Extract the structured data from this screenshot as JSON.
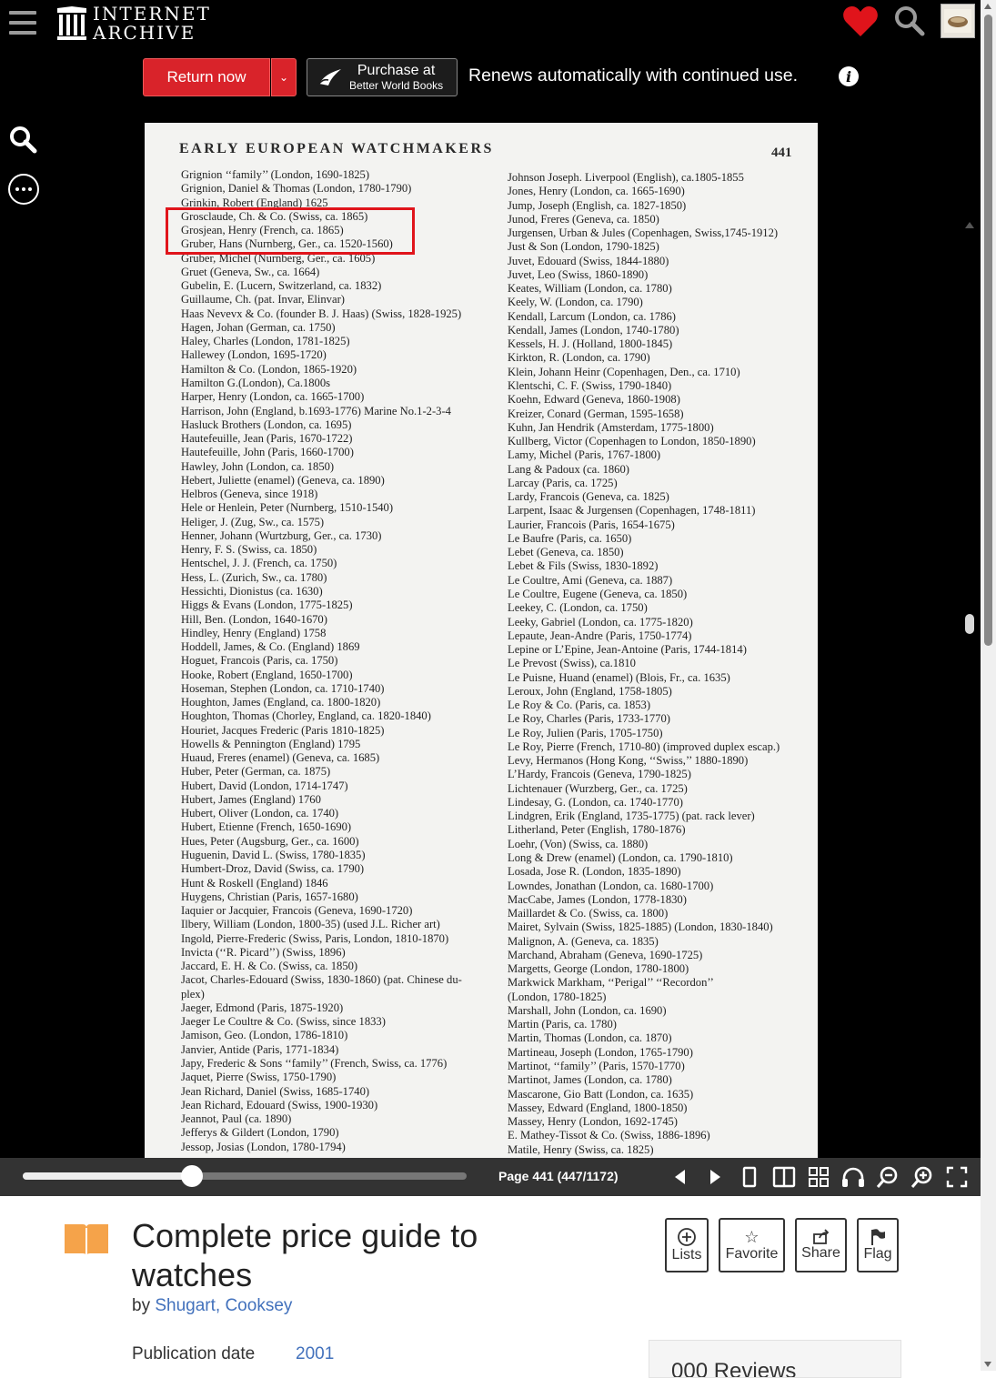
{
  "nav": {
    "logo_line1": "INTERNET",
    "logo_line2": "ARCHIVE",
    "icons": [
      "hamburger-menu-icon",
      "internet-archive-logo-icon",
      "heart-icon",
      "search-icon",
      "user-avatar"
    ],
    "accent_heart": "#e0141b"
  },
  "loan": {
    "return_label": "Return now",
    "purchase_main": "Purchase at",
    "purchase_sub": "Better World Books",
    "renew_text": "Renews automatically with continued use.",
    "info_glyph": "i",
    "return_color": "#d9232a"
  },
  "reader": {
    "page_header": "EARLY   EUROPEAN   WATCHMAKERS",
    "page_number": "441",
    "left_entries": [
      "Grignion ‘‘family’’ (London, 1690-1825)",
      "Grignion, Daniel & Thomas (London, 1780-1790)",
      "Grinkin, Robert (England) 1625",
      "Grosclaude, Ch. & Co. (Swiss, ca. 1865)",
      "Grosjean, Henry (French, ca. 1865)",
      "Gruber, Hans (Nurnberg, Ger., ca. 1520-1560)",
      "Gruber, Michel (Nurnberg, Ger., ca. 1605)",
      "Gruet (Geneva, Sw., ca. 1664)",
      "Gubelin, E. (Lucern, Switzerland, ca. 1832)",
      "Guillaume, Ch. (pat. Invar, Elinvar)",
      "Haas Nevevx & Co. (founder B. J. Haas) (Swiss, 1828-1925)",
      "Hagen, Johan (German, ca. 1750)",
      "Haley, Charles (London, 1781-1825)",
      "Hallewey (London, 1695-1720)",
      "Hamilton & Co. (London, 1865-1920)",
      "Hamilton G.(London), Ca.1800s",
      "Harper, Henry (London, ca. 1665-1700)",
      "Harrison, John (England, b.1693-1776) Marine No.1-2-3-4",
      "Hasluck Brothers (London, ca. 1695)",
      "Hautefeuille, Jean (Paris, 1670-1722)",
      "Hautefeuille, John (Paris, 1660-1700)",
      "Hawley, John (London, ca. 1850)",
      "Hebert, Juliette (enamel) (Geneva, ca. 1890)",
      "Helbros (Geneva, since 1918)",
      "Hele or Henlein, Peter (Nurnberg, 1510-1540)",
      "Heliger, J. (Zug, Sw., ca. 1575)",
      "Henner, Johann (Wurtzburg, Ger., ca. 1730)",
      "Henry, F. S. (Swiss, ca. 1850)",
      "Hentschel, J. J. (French, ca. 1750)",
      "Hess, L. (Zurich, Sw., ca. 1780)",
      "Hessichti, Dionistus (ca. 1630)",
      "Higgs & Evans (London, 1775-1825)",
      "Hill, Ben. (London, 1640-1670)",
      "Hindley, Henry (England) 1758",
      "Hoddell, James, & Co. (England) 1869",
      "Hoguet, Francois (Paris, ca. 1750)",
      "Hooke, Robert (England, 1650-1700)",
      "Hoseman, Stephen (London, ca. 1710-1740)",
      "Houghton, James (England, ca. 1800-1820)",
      "Houghton, Thomas (Chorley, England, ca. 1820-1840)",
      "Houriet, Jacques Frederic (Paris 1810-1825)",
      "Howells & Pennington (England) 1795",
      "Huaud, Freres (enamel) (Geneva, ca. 1685)",
      "Huber, Peter (German, ca. 1875)",
      "Hubert, David (London, 1714-1747)",
      "Hubert, James (England) 1760",
      "Hubert, Oliver (London, ca. 1740)",
      "Hubert, Etienne (French, 1650-1690)",
      "Hues, Peter (Augsburg, Ger., ca. 1600)",
      "Huguenin, David L. (Swiss, 1780-1835)",
      "Humbert-Droz, David (Swiss, ca. 1790)",
      "Hunt & Roskell (England) 1846",
      "Huygens, Christian (Paris, 1657-1680)",
      "Iaquier or Jacquier, Francois (Geneva, 1690-1720)",
      "Ilbery, William (London, 1800-35) (used J.L. Richer art)",
      "Ingold, Pierre-Frederic (Swiss, Paris, London, 1810-1870)",
      "Invicta (‘‘R. Picard’’) (Swiss, 1896)",
      "Jaccard, E. H. & Co. (Swiss, ca. 1850)",
      "Jacot, Charles-Edouard (Swiss, 1830-1860) (pat. Chinese du-",
      "plex)",
      "Jaeger, Edmond (Paris, 1875-1920)",
      "Jaeger Le Coultre & Co. (Swiss, since 1833)",
      "Jamison, Geo. (London, 1786-1810)",
      "Janvier, Antide (Paris, 1771-1834)",
      "Japy, Frederic & Sons ‘‘family’’ (French, Swiss, ca. 1776)",
      "Jaquet, Pierre (Swiss, 1750-1790)",
      "Jean Richard, Daniel (Swiss, 1685-1740)",
      "Jean Richard, Edouard (Swiss, 1900-1930)",
      "Jeannot, Paul (ca. 1890)",
      "Jefferys & Gildert (London, 1790)",
      "Jessop, Josias (London, 1780-1794)"
    ],
    "right_entries": [
      "Johnson Joseph. Liverpool (English), ca.1805-1855",
      "Jones, Henry (London, ca. 1665-1690)",
      "Jump, Joseph (English, ca. 1827-1850)",
      "Junod, Freres (Geneva, ca. 1850)",
      "Jurgensen, Urban & Jules (Copenhagen, Swiss,1745-1912)",
      "Just & Son (London, 1790-1825)",
      "Juvet, Edouard (Swiss, 1844-1880)",
      "Juvet, Leo (Swiss, 1860-1890)",
      "Keates, William (London, ca. 1780)",
      "Keely, W. (London, ca. 1790)",
      "Kendall, Larcum (London, ca. 1786)",
      "Kendall, James (London, 1740-1780)",
      "Kessels, H. J. (Holland, 1800-1845)",
      "Kirkton, R. (London, ca. 1790)",
      "Klein, Johann Heinr (Copenhagen, Den., ca. 1710)",
      "Klentschi, C. F. (Swiss, 1790-1840)",
      "Koehn, Edward (Geneva, 1860-1908)",
      "Kreizer, Conard (German, 1595-1658)",
      "Kuhn, Jan Hendrik (Amsterdam, 1775-1800)",
      "Kullberg, Victor (Copenhagen to London, 1850-1890)",
      "Lamy, Michel (Paris, 1767-1800)",
      "Lang & Padoux (ca. 1860)",
      "Larcay (Paris, ca. 1725)",
      "Lardy, Francois (Geneva, ca. 1825)",
      "Larpent, Isaac & Jurgensen (Copenhagen, 1748-1811)",
      "Laurier, Francois (Paris, 1654-1675)",
      "Le Baufre (Paris, ca. 1650)",
      "Lebet (Geneva, ca. 1850)",
      "Lebet & Fils (Swiss, 1830-1892)",
      "Le Coultre, Ami (Geneva, ca. 1887)",
      "Le Coultre, Eugene (Geneva, ca. 1850)",
      "Leekey, C. (London, ca. 1750)",
      "Leeky, Gabriel (London, ca. 1775-1820)",
      "Lepaute, Jean-Andre (Paris, 1750-1774)",
      "Lepine or L’Epine, Jean-Antoine (Paris, 1744-1814)",
      "Le Prevost (Swiss), ca.1810",
      "Le Puisne, Huand (enamel) (Blois, Fr., ca. 1635)",
      "Leroux, John (England, 1758-1805)",
      "Le Roy & Co. (Paris, ca. 1853)",
      "Le Roy, Charles (Paris, 1733-1770)",
      "Le Roy, Julien (Paris, 1705-1750)",
      "Le Roy, Pierre (French, 1710-80) (improved duplex escap.)",
      "Levy, Hermanos (Hong Kong, ‘‘Swiss,’’ 1880-1890)",
      "L’Hardy, Francois (Geneva, 1790-1825)",
      "Lichtenauer (Wurzberg, Ger., ca. 1725)",
      "Lindesay, G. (London, ca. 1740-1770)",
      "Lindgren, Erik (England, 1735-1775) (pat. rack lever)",
      "Litherland, Peter (English, 1780-1876)",
      "Loehr, (Von) (Swiss, ca. 1880)",
      "Long & Drew (enamel) (London, ca. 1790-1810)",
      "Losada, Jose R. (London, 1835-1890)",
      "Lowndes, Jonathan (London, ca. 1680-1700)",
      "MacCabe, James (London, 1778-1830)",
      "Maillardet & Co. (Swiss, ca. 1800)",
      "Mairet, Sylvain (Swiss, 1825-1885) (London, 1830-1840)",
      "Malignon, A. (Geneva, ca. 1835)",
      "Marchand, Abraham (Geneva, 1690-1725)",
      "Margetts, George (London, 1780-1800)",
      "Markwick Markham, ‘‘Perigal’’ ‘‘Recordon’’",
      "(London, 1780-1825)",
      "Marshall, John (London, ca. 1690)",
      "Martin (Paris, ca. 1780)",
      "Martin, Thomas (London, ca. 1870)",
      "Martineau, Joseph (London, 1765-1790)",
      "Martinot, ‘‘family’’ (Paris, 1570-1770)",
      "Martinot, James (London, ca. 1780)",
      "Mascarone, Gio Batt (London, ca. 1635)",
      "Massey, Edward (England, 1800-1850)",
      "Massey, Henry (London, 1692-1745)",
      "E. Mathey-Tissot & Co. (Swiss, 1886-1896)",
      "Matile, Henry (Swiss, ca. 1825)"
    ],
    "highlight_color": "#e0141b"
  },
  "controls": {
    "page_indicator": "Page 441 (447/1172)",
    "progress_fraction": 0.381,
    "icons": [
      "prev-page-icon",
      "next-page-icon",
      "one-page-view-icon",
      "two-page-view-icon",
      "thumbnail-view-icon",
      "read-aloud-icon",
      "zoom-out-icon",
      "zoom-in-icon",
      "fullscreen-icon"
    ]
  },
  "details": {
    "title": "Complete price guide to watches",
    "by_label": "by",
    "author": "Shugart, Cooksey",
    "actions": [
      {
        "label": "Lists",
        "icon": "plus-circle-icon"
      },
      {
        "label": "Favorite",
        "icon": "star-icon"
      },
      {
        "label": "Share",
        "icon": "share-icon"
      },
      {
        "label": "Flag",
        "icon": "flag-icon"
      }
    ],
    "pubdate_label": "Publication date",
    "pubdate_value": "2001",
    "reviews_partial": "000 Reviews",
    "link_color": "#4271bc",
    "book_icon_color": "#f5a34a"
  }
}
